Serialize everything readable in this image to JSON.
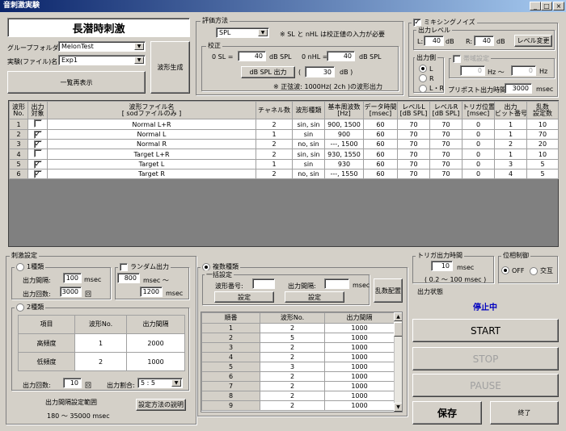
{
  "window": {
    "title": "音刺激実験",
    "minimize": "_",
    "maximize": "□",
    "close": "×"
  },
  "header": {
    "title": "長潜時刺激",
    "group_folder_label": "グループフォルダ",
    "group_folder_value": "MelonTest",
    "experiment_label": "実験(ファイル)名",
    "experiment_value": "Exp1",
    "list_button": "一覧再表示",
    "wave_gen_button": "波形生成"
  },
  "eval": {
    "group_label": "評価方法",
    "method_value": "SPL",
    "note": "※ SL と nHL は校正値の入力が必要",
    "calib_label": "校正",
    "sl_label": "0 SL =",
    "sl_value": "40",
    "sl_unit": "dB SPL",
    "nhl_label": "0 nHL =",
    "nhl_value": "40",
    "nhl_unit": "dB SPL",
    "output_button": "dB SPL 出力",
    "paren_open": "(",
    "output_value": "30",
    "output_unit": "dB )",
    "sine_note": "※ 正弦波: 1000Hz( 2ch )の波形出力"
  },
  "mixing": {
    "label": "ミキシングノイズ",
    "checked": true,
    "level_label": "出力レベル",
    "l_label": "L:",
    "l_value": "40",
    "l_unit": "dB",
    "r_label": "R:",
    "r_value": "40",
    "r_unit": "dB",
    "level_change_button": "レベル変更",
    "side_label": "出力側",
    "side_l": "L",
    "side_r": "R",
    "side_lr": "L・R",
    "side_selected": "L",
    "const_label": "帯域設定",
    "const_from": "0",
    "const_from_unit": "Hz 〜",
    "const_to": "0",
    "const_to_unit": "Hz",
    "post_label": "プリポスト出力時間:",
    "post_value": "3000",
    "post_unit": "msec"
  },
  "table": {
    "headers": [
      "波形\nNo.",
      "出力\n対象",
      "波形ファイル名\n[ sodファイルのみ ]",
      "チャネル数",
      "波形種類",
      "基本周波数\n[Hz]",
      "データ時間\n[msec]",
      "レベルL\n[dB SPL]",
      "レベルR\n[dB SPL]",
      "トリガ位置\n[msec]",
      "出力\nビット番号",
      "乱数\n設定数"
    ],
    "rows": [
      {
        "no": "1",
        "check": false,
        "file": "Normal L+R",
        "ch": "2",
        "type": "sin, sin",
        "freq": "900, 1500",
        "time": "60",
        "levl": "70",
        "levr": "70",
        "trig": "0",
        "bit": "1",
        "rand": "10"
      },
      {
        "no": "2",
        "check": true,
        "file": "Normal L",
        "ch": "1",
        "type": "sin",
        "freq": "900",
        "time": "60",
        "levl": "70",
        "levr": "70",
        "trig": "0",
        "bit": "1",
        "rand": "70"
      },
      {
        "no": "3",
        "check": true,
        "file": "Normal R",
        "ch": "2",
        "type": "no, sin",
        "freq": "---, 1500",
        "time": "60",
        "levl": "70",
        "levr": "70",
        "trig": "0",
        "bit": "2",
        "rand": "20"
      },
      {
        "no": "4",
        "check": false,
        "file": "Target L+R",
        "ch": "2",
        "type": "sin, sin",
        "freq": "930, 1550",
        "time": "60",
        "levl": "70",
        "levr": "70",
        "trig": "0",
        "bit": "1",
        "rand": "10"
      },
      {
        "no": "5",
        "check": true,
        "file": "Target L",
        "ch": "1",
        "type": "sin",
        "freq": "930",
        "time": "60",
        "levl": "70",
        "levr": "70",
        "trig": "0",
        "bit": "3",
        "rand": "5"
      },
      {
        "no": "6",
        "check": true,
        "file": "Target R",
        "ch": "2",
        "type": "no, sin",
        "freq": "---, 1550",
        "time": "60",
        "levl": "70",
        "levr": "70",
        "trig": "0",
        "bit": "4",
        "rand": "5"
      }
    ]
  },
  "stim": {
    "group_label": "刺激設定",
    "single_label": "1種類",
    "single_interval_label": "出力間隔:",
    "single_interval_value": "100",
    "single_interval_unit": "msec",
    "single_count_label": "出力回数:",
    "single_count_value": "3000",
    "single_count_unit": "回",
    "random_label": "ランダム出力",
    "random_from": "800",
    "random_from_unit": "msec 〜",
    "random_to": "1200",
    "random_to_unit": "msec",
    "two_label": "2種類",
    "two_headers": [
      "項目",
      "波形No.",
      "出力間隔"
    ],
    "two_rows": [
      {
        "item": "高頻度",
        "no": "1",
        "interval": "2000"
      },
      {
        "item": "低頻度",
        "no": "2",
        "interval": "1000"
      }
    ],
    "two_count_label": "出力回数:",
    "two_count_value": "10",
    "two_count_unit": "回",
    "ratio_label": "出力割合:",
    "ratio_value": "5 : 5",
    "range_label": "出力間隔設定範囲",
    "range_value": "180 〜 35000 msec",
    "howto_button": "設定方法の説明"
  },
  "multi": {
    "label": "複数種類",
    "bulk_label": "一括設定",
    "wave_no_label": "波形番号:",
    "interval_label": "出力間隔:",
    "interval_unit": "msec",
    "set1": "設定",
    "set2": "設定",
    "random_button": "乱数配置",
    "headers": [
      "順番",
      "波形No.",
      "出力間隔"
    ],
    "rows": [
      {
        "o": "1",
        "w": "2",
        "i": "1000"
      },
      {
        "o": "2",
        "w": "5",
        "i": "1000"
      },
      {
        "o": "3",
        "w": "2",
        "i": "1000"
      },
      {
        "o": "4",
        "w": "2",
        "i": "1000"
      },
      {
        "o": "5",
        "w": "3",
        "i": "1000"
      },
      {
        "o": "6",
        "w": "2",
        "i": "1000"
      },
      {
        "o": "7",
        "w": "2",
        "i": "1000"
      },
      {
        "o": "8",
        "w": "2",
        "i": "1000"
      },
      {
        "o": "9",
        "w": "2",
        "i": "1000"
      }
    ]
  },
  "trigger": {
    "label": "トリガ出力時間",
    "value": "10",
    "unit": "msec",
    "range": "( 0.2 〜 100 msec )"
  },
  "phase": {
    "label": "位相制御",
    "off": "OFF",
    "alt": "交互",
    "selected": "OFF"
  },
  "status": {
    "label": "出力状態",
    "value": "停止中",
    "start": "START",
    "stop": "STOP",
    "pause": "PAUSE",
    "save": "保存",
    "end": "終了"
  }
}
